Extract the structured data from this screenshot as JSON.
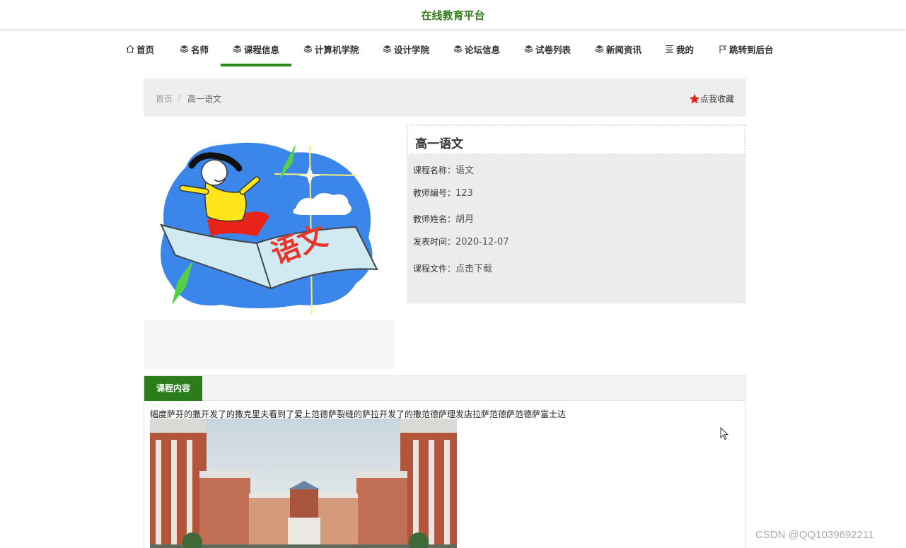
{
  "header": {
    "title": "在线教育平台"
  },
  "nav": {
    "items": [
      {
        "label": "首页",
        "icon": "home-icon"
      },
      {
        "label": "名师",
        "icon": "layers-icon"
      },
      {
        "label": "课程信息",
        "icon": "layers-icon",
        "active": true
      },
      {
        "label": "计算机学院",
        "icon": "layers-icon"
      },
      {
        "label": "设计学院",
        "icon": "layers-icon"
      },
      {
        "label": "论坛信息",
        "icon": "layers-icon"
      },
      {
        "label": "试卷列表",
        "icon": "layers-icon"
      },
      {
        "label": "新闻资讯",
        "icon": "layers-icon"
      },
      {
        "label": "我的",
        "icon": "menu-lines-icon"
      },
      {
        "label": "跳转到后台",
        "icon": "flag-icon"
      }
    ]
  },
  "breadcrumb": {
    "home": "首页",
    "separator": "/",
    "current": "高一语文"
  },
  "favorite": {
    "label": "点我收藏",
    "icon": "star-icon"
  },
  "course": {
    "title": "高一语文",
    "fields": [
      {
        "label": "课程名称：",
        "value": "语文"
      },
      {
        "label": "教师编号：",
        "value": "123"
      },
      {
        "label": "教师姓名：",
        "value": "胡月"
      },
      {
        "label": "发表时间：",
        "value": "2020-12-07"
      },
      {
        "label": "课程文件：",
        "value": "点击下载"
      }
    ],
    "cover_text": "语文"
  },
  "content": {
    "tab_label": "课程内容",
    "text": "幅度萨芬的撒开发了的撒克里夫看到了爱上范德萨裂缝的萨拉开发了的撒范德萨理发店拉萨范德萨范德萨富士达"
  },
  "watermark": "CSDN @QQ1039692211",
  "colors": {
    "brand_green": "#2f7d1b",
    "tab_green": "#2a7d1a",
    "star_red": "#e8231a"
  }
}
